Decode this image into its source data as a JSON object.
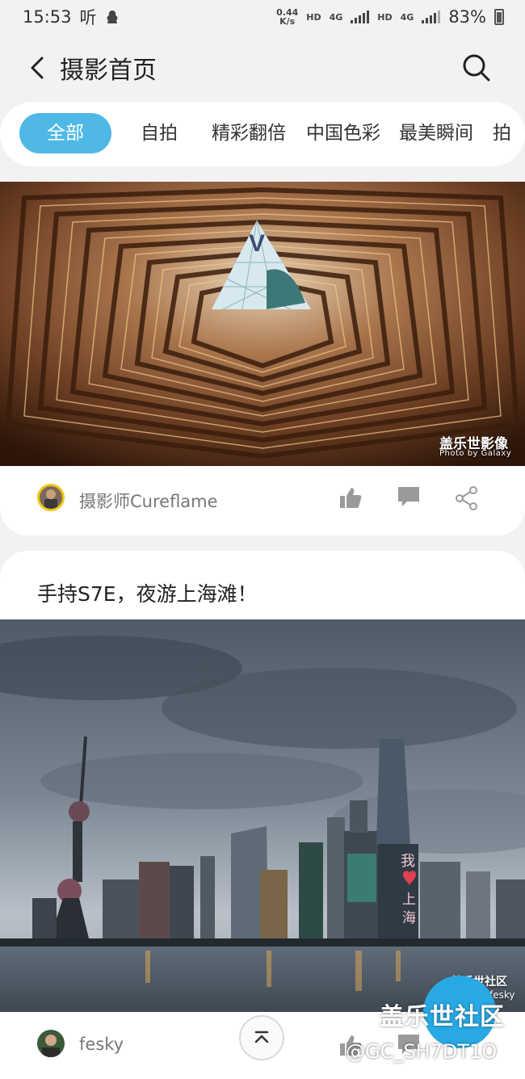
{
  "status_bar": {
    "time": "15:53",
    "carrier_glyph": "听",
    "speed_value": "0.44",
    "speed_unit": "K/s",
    "hd1": "HD",
    "net1": "4G",
    "hd2": "HD",
    "net2": "4G",
    "battery": "83%"
  },
  "header": {
    "title": "摄影首页"
  },
  "tabs": [
    "全部",
    "自拍",
    "精彩翻倍",
    "中国色彩",
    "最美瞬间",
    "拍"
  ],
  "posts": [
    {
      "watermark_main": "盖乐世影像",
      "watermark_sub": "Photo by Galaxy",
      "author": "摄影师Cureflame"
    },
    {
      "title": "手持S7E，夜游上海滩！",
      "photo_signs": [
        "我",
        "上",
        "海"
      ],
      "watermark_main": "盖乐世社区",
      "watermark_sub": "fesky",
      "author": "fesky"
    }
  ],
  "overlay": {
    "community_watermark": "盖乐世社区",
    "user_id": "@GC_SH7DT1O"
  },
  "colors": {
    "accent": "#4fb8e6",
    "fab": "#28a9e4",
    "background": "#f2f2f2"
  },
  "icons": [
    "back-icon",
    "search-icon",
    "thumbs-up-icon",
    "comment-icon",
    "share-icon",
    "scroll-top-icon"
  ]
}
